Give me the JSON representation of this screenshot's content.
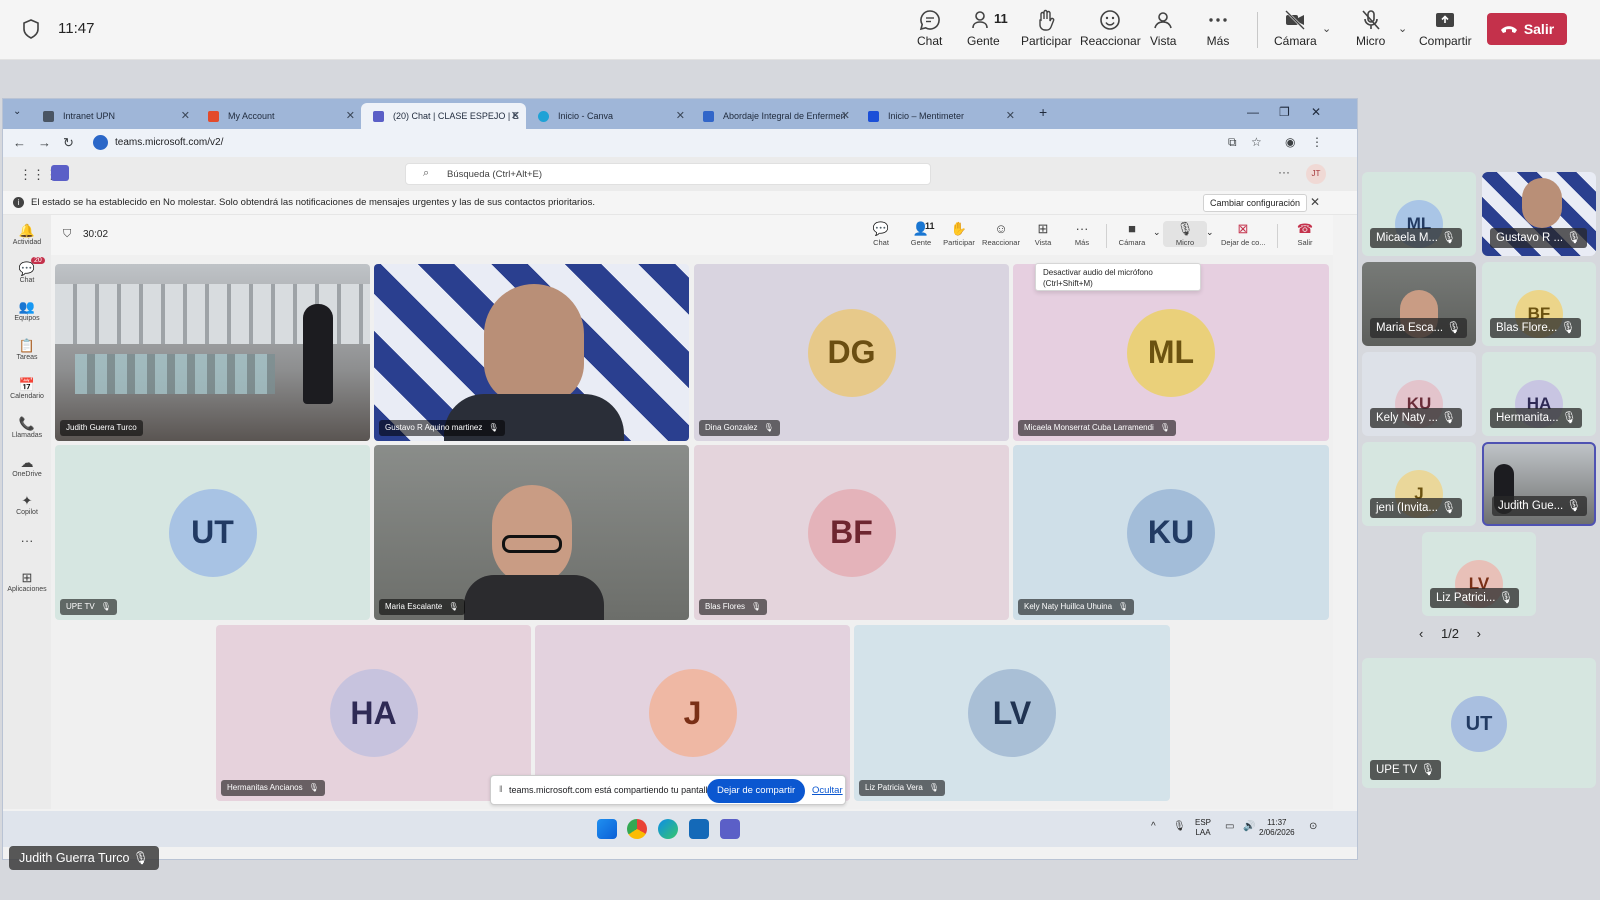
{
  "outer_bar": {
    "time": "11:47",
    "buttons": {
      "chat": "Chat",
      "people": "Gente",
      "people_count": "11",
      "raise": "Participar",
      "react": "Reaccionar",
      "view": "Vista",
      "more": "Más",
      "camera": "Cámara",
      "mic": "Micro",
      "share": "Compartir"
    },
    "leave": "Salir"
  },
  "browser": {
    "tabs": [
      {
        "title": "Intranet UPN",
        "color": "#4a5563"
      },
      {
        "title": "My Account",
        "color": "#e34b2c"
      },
      {
        "title": "(20) Chat | CLASE ESPEJO | E",
        "color": "#5b5fc7"
      },
      {
        "title": "Inicio - Canva",
        "color": "#1fa2d6"
      },
      {
        "title": "Abordaje Integral de Enfermeri",
        "color": "#3266c9"
      },
      {
        "title": "Inicio – Mentimeter",
        "color": "#1b4fd8"
      }
    ],
    "url": "teams.microsoft.com/v2/"
  },
  "teams": {
    "search_placeholder": "Búsqueda (Ctrl+Alt+E)",
    "me_initials": "JT",
    "banner": {
      "message": "El estado se ha establecido en No molestar. Solo obtendrá las notificaciones de mensajes urgentes y las de sus contactos prioritarios.",
      "button": "Cambiar configuración"
    },
    "rail": [
      {
        "label": "Actividad",
        "icon": "🔔"
      },
      {
        "label": "Chat",
        "icon": "💬",
        "badge": "20"
      },
      {
        "label": "Equipos",
        "icon": "👥"
      },
      {
        "label": "Tareas",
        "icon": "📋"
      },
      {
        "label": "Calendario",
        "icon": "📅"
      },
      {
        "label": "Llamadas",
        "icon": "📞"
      },
      {
        "label": "OneDrive",
        "icon": "☁"
      },
      {
        "label": "Copilot",
        "icon": "✦"
      },
      {
        "label": "Aplicaciones",
        "icon": "⊞"
      }
    ],
    "meeting": {
      "timer": "30:02",
      "chat": "Chat",
      "people": "Gente",
      "people_count": "11",
      "raise": "Participar",
      "react": "Reaccionar",
      "view": "Vista",
      "more": "Más",
      "camera": "Cámara",
      "mic": "Micro",
      "stop_share": "Dejar de co...",
      "leave": "Salir"
    },
    "tooltip": {
      "line1": "Desactivar audio del micrófono",
      "line2": "(Ctrl+Shift+M)"
    },
    "tiles": [
      {
        "name": "Judith Guerra Turco",
        "type": "video"
      },
      {
        "name": "Gustavo R Aquino martinez",
        "type": "video"
      },
      {
        "name": "Dina Gonzalez",
        "initials": "DG",
        "bg": "#d9d4e0",
        "av": "#e7c98a",
        "fg": "#6b4e12"
      },
      {
        "name": "Micaela Monserrat Cuba Larramendi",
        "initials": "ML",
        "bg": "#e6cfe0",
        "av": "#ead07a",
        "fg": "#6b5210"
      },
      {
        "name": "UPE TV",
        "initials": "UT",
        "bg": "#d6e6e1",
        "av": "#a8c3e4",
        "fg": "#213a63"
      },
      {
        "name": "Maria Escalante",
        "type": "video"
      },
      {
        "name": "Blas Flores",
        "initials": "BF",
        "bg": "#e4d4dc",
        "av": "#e4b3ba",
        "fg": "#6e2630"
      },
      {
        "name": "Kely Naty Huillca Uhuina",
        "initials": "KU",
        "bg": "#cfdfe8",
        "av": "#a3bdd9",
        "fg": "#213a63"
      },
      {
        "name": "Hermanitas Ancianos",
        "initials": "HA",
        "bg": "#e6d2dc",
        "av": "#c7c3de",
        "fg": "#2f2a55"
      },
      {
        "name": "",
        "initials": "J",
        "bg": "#e3d2de",
        "av": "#efb8a4",
        "fg": "#7a2f16"
      },
      {
        "name": "Liz Patricia Vera",
        "initials": "LV",
        "bg": "#d4e3ea",
        "av": "#a9bfd6",
        "fg": "#203352"
      }
    ],
    "share_bar": {
      "message": "teams.microsoft.com está compartiendo tu pantalla.",
      "stop": "Dejar de compartir",
      "hide": "Ocultar"
    },
    "taskbar": {
      "lang1": "ESP",
      "lang2": "LAA",
      "time": "11:37",
      "date": "2/06/2026"
    }
  },
  "bottom_label": "Judith Guerra Turco",
  "gallery": [
    {
      "name": "Micaela M...",
      "initials": "ML",
      "bg": "#d5e6df",
      "av": "#a9c5e6",
      "fg": "#223a62",
      "mic": "🎙"
    },
    {
      "name": "Gustavo R ...",
      "type": "video",
      "mic": "🎙"
    },
    {
      "name": "Maria Esca...",
      "type": "video",
      "mic": "🎙"
    },
    {
      "name": "Blas Flore...",
      "initials": "BF",
      "bg": "#d6e6e0",
      "av": "#ecd58a",
      "fg": "#6b5210",
      "mic": "🎙"
    },
    {
      "name": "Kely Naty ...",
      "initials": "KU",
      "bg": "#dde1e8",
      "av": "#e3c4cc",
      "fg": "#6b2e3a",
      "mic": "🎙"
    },
    {
      "name": "Hermanita...",
      "initials": "HA",
      "bg": "#d6e6e0",
      "av": "#c8c5e2",
      "fg": "#2f2a55",
      "mic": "🎙"
    },
    {
      "name": "jeni (Invita...",
      "initials": "J",
      "bg": "#d6e6e0",
      "av": "#ead79a",
      "fg": "#6b5210",
      "mic": "🎙"
    },
    {
      "name": "Judith Gue...",
      "type": "video",
      "mic": "🎙"
    },
    {
      "name": "Liz Patrici...",
      "initials": "LV",
      "bg": "#d6e6e0",
      "av": "#e8c0b8",
      "fg": "#7a2f16",
      "mic": "🎙"
    },
    {
      "name": "UPE TV",
      "initials": "UT",
      "bg": "#d6e6e0",
      "av": "#a9bfe0",
      "fg": "#223a62",
      "mic": "🎙"
    }
  ],
  "pager": "1/2"
}
